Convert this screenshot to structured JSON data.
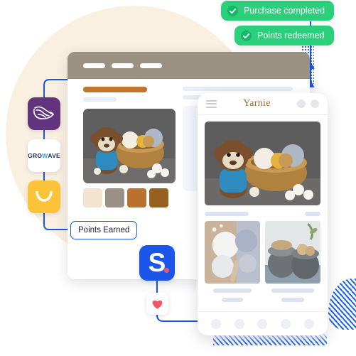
{
  "badges": [
    {
      "label": "Purchase completed",
      "icon": "check-seal-icon",
      "color": "#2BD07C"
    },
    {
      "label": "Points redeemed",
      "icon": "check-seal-icon",
      "color": "#2BD07C"
    }
  ],
  "browser": {
    "nav_pills": 3,
    "bar_color": "#9B9183",
    "accent_bar_color": "#C2762D",
    "swatches": [
      "#F2E4CE",
      "#9A9086",
      "#B9712D",
      "#96601F"
    ],
    "hero_alt": "crocheted-monkey-with-yarn-basket"
  },
  "phone": {
    "store_title": "Yarnie",
    "menu_icon": "hamburger-menu-icon",
    "header_icons": [
      "search-icon",
      "cart-icon"
    ],
    "hero_alt": "crocheted-monkey-with-yarn-basket",
    "thumbnails": [
      {
        "alt": "white-and-grey-yarn-balls"
      },
      {
        "alt": "woven-grey-baskets"
      }
    ],
    "nav_items": 5
  },
  "flow": {
    "apps": [
      {
        "name": "loyalty-app-icon",
        "color": "#63347E",
        "label": ""
      },
      {
        "name": "growave-app-icon",
        "color": "#FFFFFF",
        "label_parts": [
          "GRO",
          "W",
          "AVE"
        ]
      },
      {
        "name": "rewards-app-icon",
        "color": "#FCC238",
        "label": ""
      }
    ],
    "pill_label": "Points Earned",
    "shop_icon": {
      "name": "shopify-s-icon",
      "letter": "S",
      "color": "#1B56E8",
      "dot_color": "#F2566B"
    },
    "wishlist_icon": {
      "name": "heart-icon",
      "color": "#F2566B"
    },
    "line_color": "#1B56E8"
  },
  "decor": {
    "circle_color": "#FAF0E2",
    "dot_pattern_color": "#1B4FD8",
    "stripe_color": "#1B63F0"
  }
}
